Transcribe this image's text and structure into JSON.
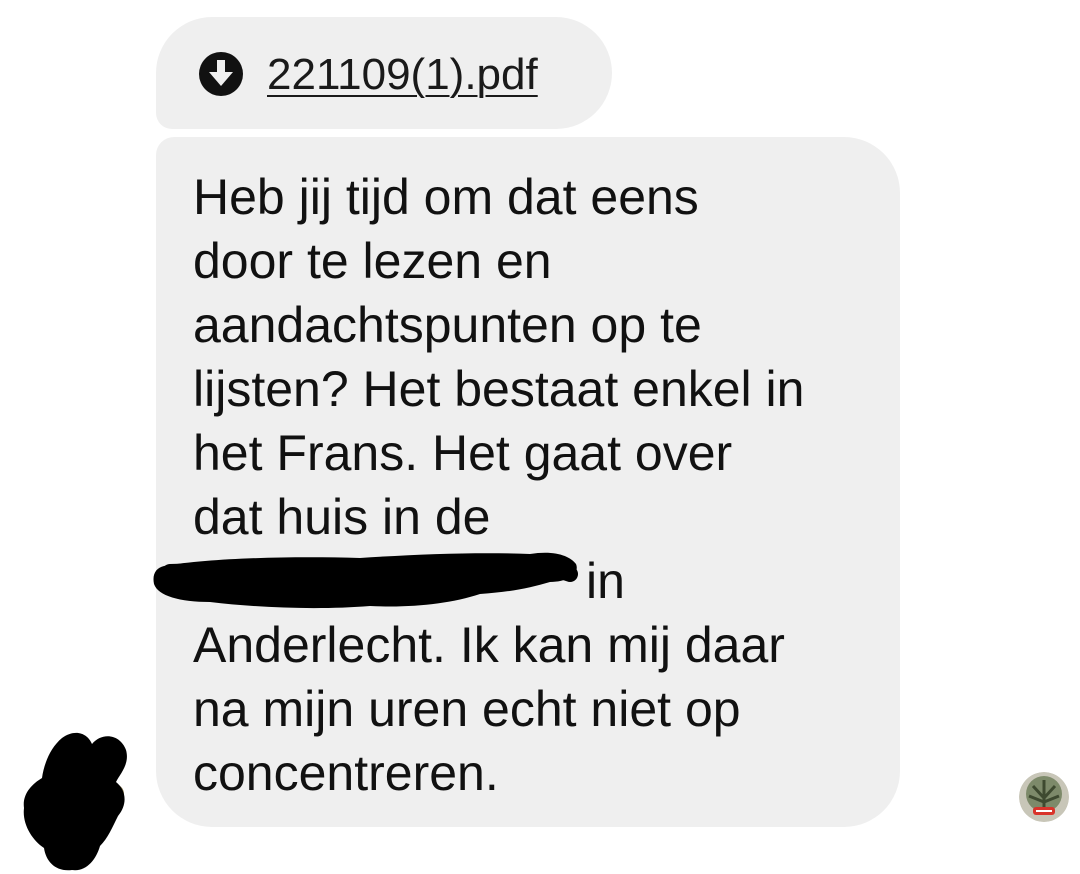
{
  "conversation": {
    "attachment": {
      "icon": "download-icon",
      "file_name": "221109(1).pdf"
    },
    "message": {
      "lines": [
        "Heb jij tijd om dat eens",
        "door te lezen en",
        "aandachtspunten op te",
        "lijsten? Het bestaat enkel in",
        "het Frans. Het gaat over",
        "dat huis in de",
        "in",
        "Anderlecht. Ik kan mij daar",
        "na mijn uren echt niet op",
        "concentreren."
      ]
    },
    "sender_avatar": {
      "icon": "avatar-icon",
      "redacted": true
    },
    "read_receipt": {
      "icon": "seen-avatar-icon"
    }
  },
  "colors": {
    "bubble_background": "#efefef",
    "text": "#111111",
    "redaction": "#000000",
    "page_background": "#ffffff"
  }
}
